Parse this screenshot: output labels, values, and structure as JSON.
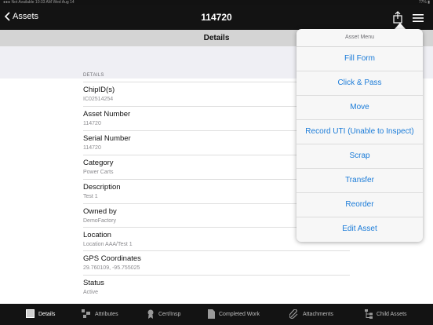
{
  "statusbar": {
    "left": "●●● Not Available  10:33 AM  Wed Aug 14",
    "right": "77% ▮"
  },
  "nav": {
    "back_label": "Assets",
    "title": "114720"
  },
  "subheader": {
    "title": "Details"
  },
  "details": {
    "section_label": "DETAILS",
    "rows": [
      {
        "label": "ChipID(s)",
        "value": "IC02514254"
      },
      {
        "label": "Asset Number",
        "value": "114720"
      },
      {
        "label": "Serial Number",
        "value": "114720"
      },
      {
        "label": "Category",
        "value": "Power Carts"
      },
      {
        "label": "Description",
        "value": "Test 1"
      },
      {
        "label": "Owned by",
        "value": "DemoFactory"
      },
      {
        "label": "Location",
        "value": "Location AAA/Test 1"
      },
      {
        "label": "GPS Coordinates",
        "value": "29.760109, -95.755025"
      },
      {
        "label": "Status",
        "value": "Active"
      }
    ]
  },
  "menu": {
    "title": "Asset Menu",
    "items": [
      "Fill Form",
      "Click & Pass",
      "Move",
      "Record UTI (Unable to Inspect)",
      "Scrap",
      "Transfer",
      "Reorder",
      "Edit Asset"
    ]
  },
  "tabs": [
    {
      "label": "Details",
      "icon": "details-icon"
    },
    {
      "label": "Attributes",
      "icon": "attributes-icon"
    },
    {
      "label": "Cert/Insp",
      "icon": "certificate-icon"
    },
    {
      "label": "Completed Work",
      "icon": "document-icon"
    },
    {
      "label": "Attachments",
      "icon": "paperclip-icon"
    },
    {
      "label": "Child Assets",
      "icon": "hierarchy-icon"
    }
  ],
  "colors": {
    "accent": "#1a7bd8",
    "navbar": "#131313",
    "subheader": "#d4d4d4"
  }
}
